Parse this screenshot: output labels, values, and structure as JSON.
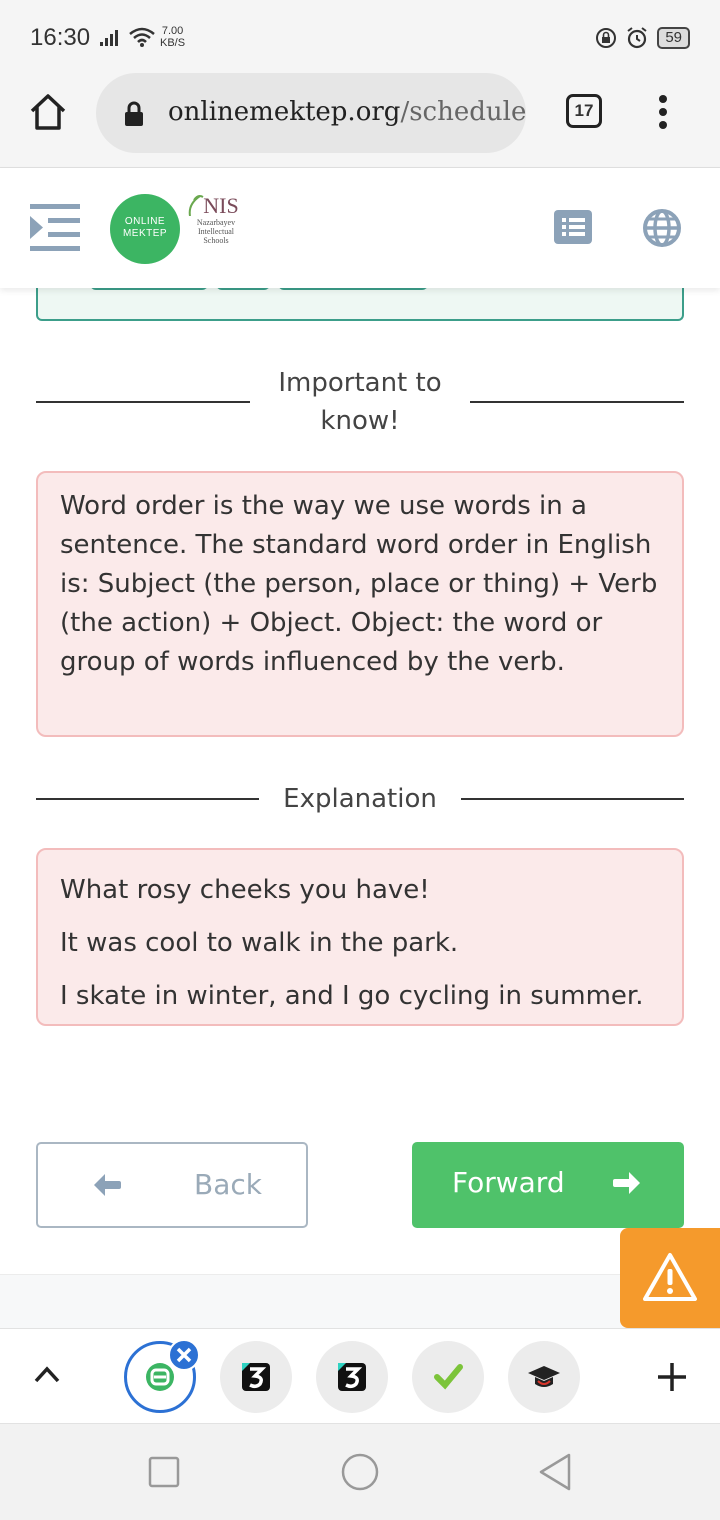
{
  "status_bar": {
    "time": "16:30",
    "net_speed_value": "7.00",
    "net_speed_unit": "KB/S",
    "battery": "59"
  },
  "browser": {
    "url_host": "onlinemektep.org",
    "url_path": "/schedule",
    "tab_count": "17"
  },
  "header": {
    "logo_online_line1": "ONLINE",
    "logo_online_line2": "MEKTEP",
    "logo_nis": "NIS",
    "logo_nis_sub1": "Nazarbayev",
    "logo_nis_sub2": "Intellectual",
    "logo_nis_sub3": "Schools"
  },
  "sections": {
    "important_heading": "Important to know!",
    "important_text": "Word order is the way we use words in a sentence. The standard word order in English is: Subject (the person, place or thing) + Verb (the action) + Object. Object: the word or group of words influenced by the verb.",
    "explanation_heading": "Explanation",
    "explanation_lines": [
      "What rosy cheeks you have!",
      "It was cool to walk in the park.",
      "I skate in winter, and I go cycling in summer."
    ]
  },
  "navigation": {
    "back_label": "Back",
    "forward_label": "Forward"
  },
  "colors": {
    "accent_green": "#4fc26a",
    "info_bg": "#fbeaea",
    "info_border": "#f3bcbc",
    "warning": "#f59a2c",
    "tab_active": "#2c71d4"
  }
}
